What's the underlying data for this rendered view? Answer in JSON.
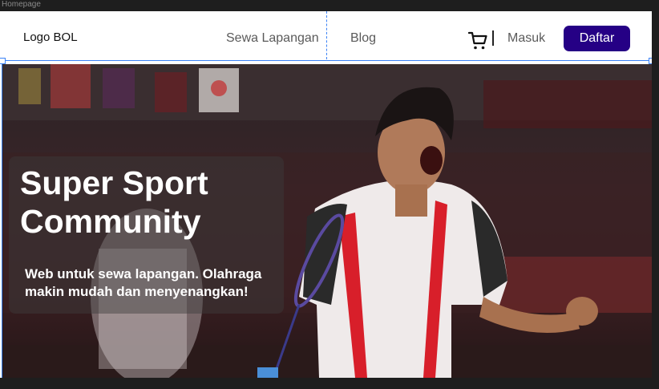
{
  "canvas": {
    "frame_label": "Homepage"
  },
  "navbar": {
    "logo": "Logo BOL",
    "links": [
      {
        "label": "Sewa Lapangan"
      },
      {
        "label": "Blog"
      }
    ],
    "cart_icon": "shopping-cart-icon",
    "login_label": "Masuk",
    "register_label": "Daftar"
  },
  "hero": {
    "title_line1": "Super Sport",
    "title_line2": "Community",
    "subtitle": "Web untuk sewa lapangan. Olahraga makin mudah dan menyenangkan!"
  },
  "colors": {
    "primary_button": "#250085",
    "selection": "#3b82f6",
    "canvas": "#1e1e1e"
  }
}
